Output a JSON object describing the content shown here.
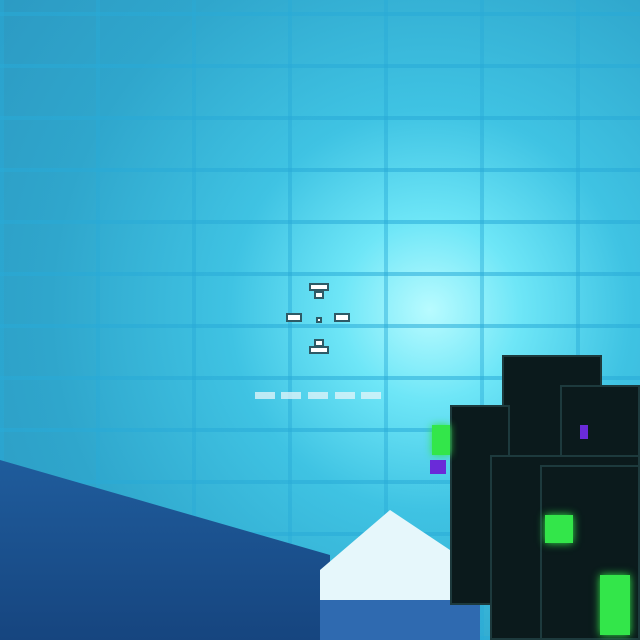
{
  "hud": {
    "crosshair": "crosshair-icon",
    "cooldown_segments_total": 5,
    "cooldown_segments_filled": 5
  },
  "colors": {
    "wall": "#3fc3e3",
    "glow": "#33e64a",
    "weapon": "#0b1a1c",
    "accent": "#6a2bd8"
  }
}
